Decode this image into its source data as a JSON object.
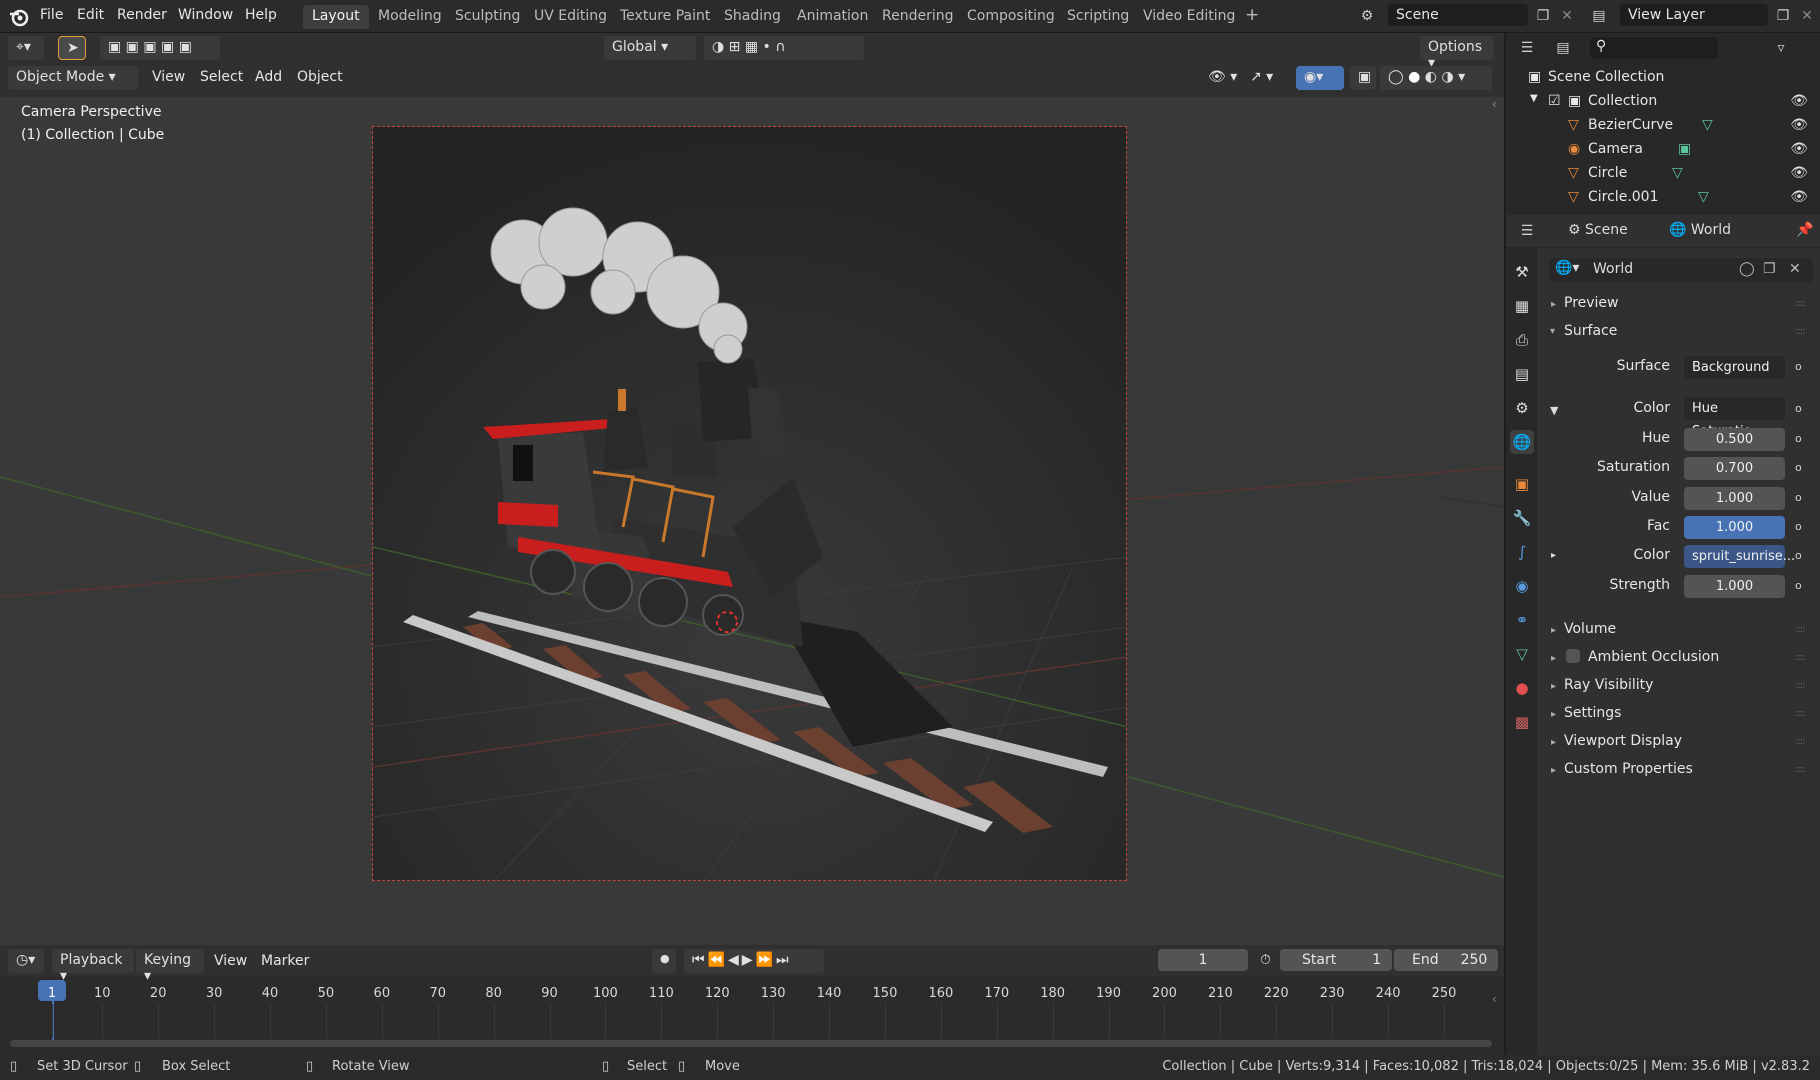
{
  "menu": {
    "file": "File",
    "edit": "Edit",
    "render": "Render",
    "window": "Window",
    "help": "Help"
  },
  "workspaces": [
    "Layout",
    "Modeling",
    "Sculpting",
    "UV Editing",
    "Texture Paint",
    "Shading",
    "Animation",
    "Rendering",
    "Compositing",
    "Scripting",
    "Video Editing"
  ],
  "add_tab": "+",
  "scene_name": "Scene",
  "view_layer": "View Layer",
  "toolbar": {
    "transform_orientation": "Global",
    "options": "Options"
  },
  "viewport_header": {
    "mode": "Object Mode",
    "view": "View",
    "select": "Select",
    "add": "Add",
    "object": "Object"
  },
  "viewport": {
    "perspective": "Camera Perspective",
    "collection_info": "(1) Collection | Cube"
  },
  "outliner": {
    "scene_collection": "Scene Collection",
    "collection": "Collection",
    "items": [
      "BezierCurve",
      "Camera",
      "Circle",
      "Circle.001"
    ]
  },
  "props_header": {
    "scene": "Scene",
    "world": "World"
  },
  "world_block": "World",
  "panels": {
    "preview": "Preview",
    "surface_panel": "Surface",
    "surface_label": "Surface",
    "surface_value": "Background",
    "color_label": "Color",
    "color_value": "Hue Saturatio...",
    "hue_label": "Hue",
    "hue_value": "0.500",
    "sat_label": "Saturation",
    "sat_value": "0.700",
    "val_label": "Value",
    "val_value": "1.000",
    "fac_label": "Fac",
    "fac_value": "1.000",
    "color2_label": "Color",
    "color2_value": "spruit_sunrise...",
    "strength_label": "Strength",
    "strength_value": "1.000",
    "volume": "Volume",
    "ao": "Ambient Occlusion",
    "ray": "Ray Visibility",
    "settings": "Settings",
    "vp_display": "Viewport Display",
    "custom": "Custom Properties"
  },
  "timeline": {
    "playback": "Playback",
    "keying": "Keying",
    "view": "View",
    "marker": "Marker",
    "current_frame": "1",
    "start_label": "Start",
    "start": "1",
    "end_label": "End",
    "end": "250",
    "ticks": [
      "1",
      "10",
      "20",
      "30",
      "40",
      "50",
      "60",
      "70",
      "80",
      "90",
      "100",
      "110",
      "120",
      "130",
      "140",
      "150",
      "160",
      "170",
      "180",
      "190",
      "200",
      "210",
      "220",
      "230",
      "240",
      "250"
    ]
  },
  "status": {
    "cursor": "Set 3D Cursor",
    "box": "Box Select",
    "rotate": "Rotate View",
    "select": "Select",
    "move": "Move",
    "stats": "Collection | Cube | Verts:9,314 | Faces:10,082 | Tris:18,024 | Objects:0/25 | Mem: 35.6 MiB | v2.83.2"
  },
  "colors": {
    "accent": "#4772b3",
    "engine_red": "#c81e1e",
    "smoke": "#d2d2d2"
  }
}
